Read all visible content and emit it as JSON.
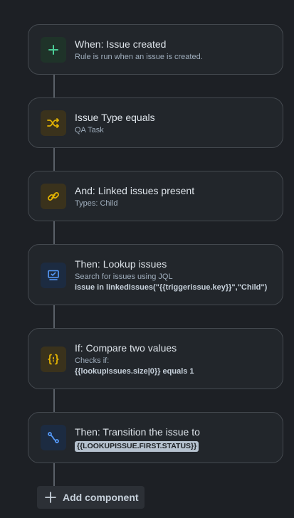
{
  "rule": {
    "trigger": {
      "title": "When: Issue created",
      "description": "Rule is run when an issue is created.",
      "icon": "plus-icon",
      "color": "#4bce97"
    },
    "condition_issue_type": {
      "title": "Issue Type equals",
      "description": "QA Task",
      "icon": "shuffle-icon",
      "color": "#e2b203"
    },
    "condition_linked": {
      "title": "And: Linked issues present",
      "description": "Types: Child",
      "icon": "link-icon",
      "color": "#e2b203"
    },
    "action_lookup": {
      "title": "Then: Lookup issues",
      "description": "Search for issues using JQL",
      "detail": "issue in linkedIssues(\"{{triggerissue.key}}\",\"Child\")",
      "icon": "monitor-check-icon",
      "color": "#579dff"
    },
    "condition_compare": {
      "title": "If: Compare two values",
      "description": "Checks if:",
      "detail": "{{lookupIssues.size|0}} equals 1",
      "icon": "braces-icon",
      "color": "#e2b203"
    },
    "action_transition": {
      "title": "Then: Transition the issue to",
      "tag": "{{LOOKUPISSUE.FIRST.STATUS}}",
      "icon": "transition-icon",
      "color": "#579dff"
    }
  },
  "add_component": {
    "label": "Add component",
    "icon": "plus-icon"
  }
}
